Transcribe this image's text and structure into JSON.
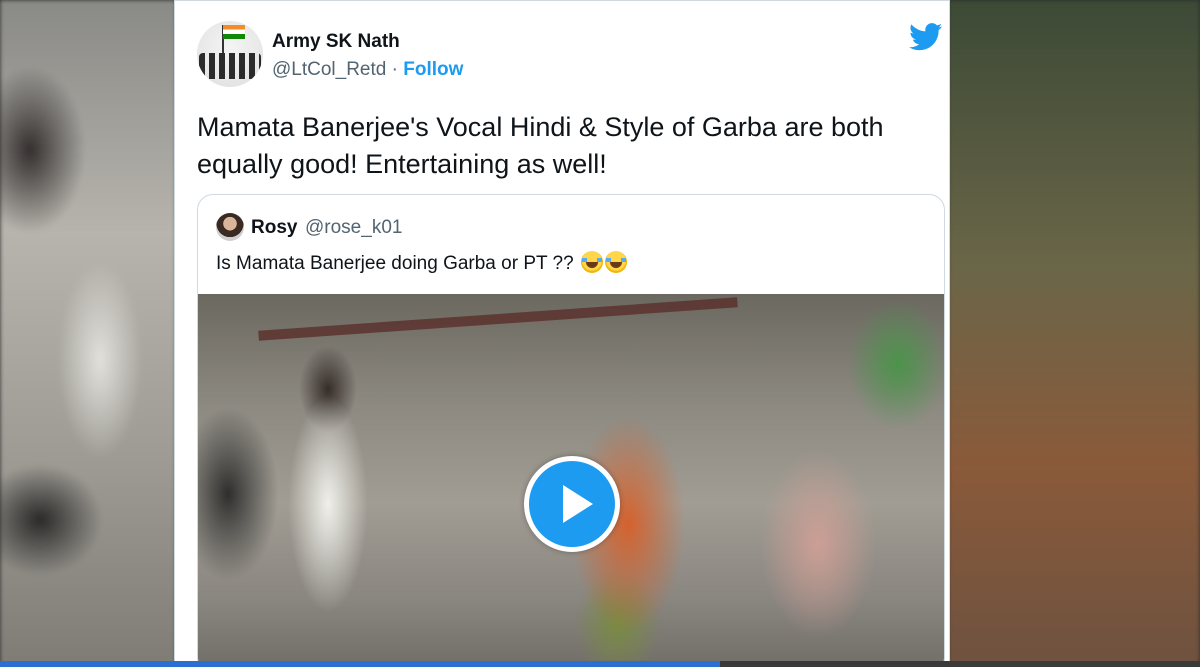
{
  "tweet": {
    "author_name": "Army SK Nath",
    "author_handle": "@LtCol_Retd",
    "separator": "·",
    "follow_label": "Follow",
    "text": "Mamata Banerjee's Vocal Hindi & Style of Garba are both equally good! Entertaining as well!"
  },
  "quoted_tweet": {
    "author_name": "Rosy",
    "author_handle": "@rose_k01",
    "text": "Is Mamata Banerjee doing Garba or PT ??",
    "emoji": [
      "face-with-tears-of-joy",
      "face-with-tears-of-joy"
    ]
  },
  "video": {
    "play_icon": "play-icon",
    "progress_fraction": 0.6
  },
  "icons": {
    "brand": "twitter-bird-icon"
  },
  "colors": {
    "brand_blue": "#1d9bf0",
    "text_primary": "#0f1419",
    "text_secondary": "#536471",
    "border": "#cfd9de",
    "progress": "#2a6fd1"
  }
}
